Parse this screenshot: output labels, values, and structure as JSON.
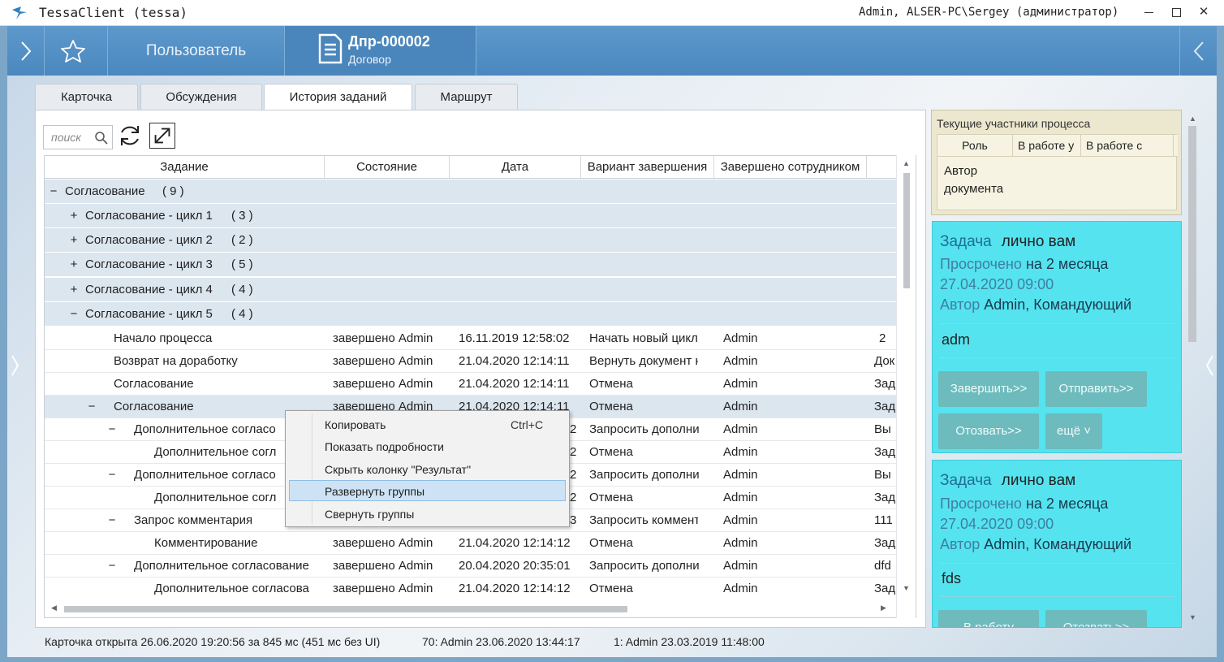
{
  "window": {
    "title": "TessaClient (tessa)",
    "user": "Admin, ALSER-PC\\Sergey (администратор)"
  },
  "toolbar": {
    "user_tab": "Пользователь",
    "doc_number": "Дпр-000002",
    "doc_type": "Договор"
  },
  "tabs": [
    "Карточка",
    "Обсуждения",
    "История заданий",
    "Маршрут"
  ],
  "active_tab": "История заданий",
  "search": {
    "placeholder": "поиск"
  },
  "grid": {
    "columns": [
      "Задание",
      "Состояние",
      "Дата",
      "Вариант завершения",
      "Завершено сотрудником"
    ],
    "groups": [
      {
        "toggle": "−",
        "label": "Согласование",
        "count": "( 9 )"
      },
      {
        "toggle": "+",
        "label": "Согласование - цикл 1",
        "count": "( 3 )"
      },
      {
        "toggle": "+",
        "label": "Согласование - цикл 2",
        "count": "( 2 )"
      },
      {
        "toggle": "+",
        "label": "Согласование - цикл 3",
        "count": "( 5 )"
      },
      {
        "toggle": "+",
        "label": "Согласование - цикл 4",
        "count": "( 4 )"
      },
      {
        "toggle": "−",
        "label": "Согласование - цикл 5",
        "count": "( 4 )"
      }
    ],
    "rows": [
      {
        "toggle": "",
        "task": "Начало процесса",
        "state": "завершено Admin",
        "date": "16.11.2019 12:58:02",
        "option": "Начать новый цикл",
        "by": "Admin",
        "result": "2"
      },
      {
        "toggle": "",
        "task": "Возврат на доработку",
        "state": "завершено Admin",
        "date": "21.04.2020 12:14:11",
        "option": "Вернуть документ н",
        "by": "Admin",
        "result": "Док"
      },
      {
        "toggle": "",
        "task": "Согласование",
        "state": "завершено Admin",
        "date": "21.04.2020 12:14:11",
        "option": "Отмена",
        "by": "Admin",
        "result": "Зад"
      },
      {
        "toggle": "−",
        "task": "Согласование",
        "state": "завершено Admin",
        "date": "21.04.2020 12:14:11",
        "option": "Отмена",
        "by": "Admin",
        "result": "Зад"
      },
      {
        "toggle": "−",
        "task": "Дополнительное согласо",
        "state": "",
        "date": "2",
        "option": "Запросить дополни",
        "by": "Admin",
        "result": "Вы"
      },
      {
        "toggle": "",
        "task": "Дополнительное согл",
        "state": "",
        "date": "2",
        "option": "Отмена",
        "by": "Admin",
        "result": "Зад"
      },
      {
        "toggle": "−",
        "task": "Дополнительное согласо",
        "state": "",
        "date": "2",
        "option": "Запросить дополни",
        "by": "Admin",
        "result": "Вы"
      },
      {
        "toggle": "",
        "task": "Дополнительное согл",
        "state": "",
        "date": "2",
        "option": "Отмена",
        "by": "Admin",
        "result": "Зад"
      },
      {
        "toggle": "−",
        "task": "Запрос комментария",
        "state": "",
        "date": "3",
        "option": "Запросить коммент",
        "by": "Admin",
        "result": "111"
      },
      {
        "toggle": "",
        "task": "Комментирование",
        "state": "завершено Admin",
        "date": "21.04.2020 12:14:12",
        "option": "Отмена",
        "by": "Admin",
        "result": "Зад"
      },
      {
        "toggle": "−",
        "task": "Дополнительное согласование",
        "state": "завершено Admin",
        "date": "20.04.2020 20:35:01",
        "option": "Запросить дополни",
        "by": "Admin",
        "result": "dfd"
      },
      {
        "toggle": "",
        "task": "Дополнительное согласова",
        "state": "завершено Admin",
        "date": "21.04.2020 12:14:12",
        "option": "Отмена",
        "by": "Admin",
        "result": "Зад"
      }
    ]
  },
  "context_menu": {
    "items": [
      {
        "label": "Копировать",
        "shortcut": "Ctrl+C"
      },
      {
        "label": "Показать подробности",
        "shortcut": ""
      },
      {
        "label": "Скрыть колонку \"Результат\"",
        "shortcut": ""
      },
      {
        "label": "Развернуть группы",
        "shortcut": ""
      },
      {
        "label": "Свернуть группы",
        "shortcut": ""
      }
    ],
    "highlighted": "Развернуть группы"
  },
  "participants": {
    "title": "Текущие участники процесса",
    "columns": [
      "Роль",
      "В работе у",
      "В работе с"
    ],
    "role_value": "Автор документа"
  },
  "tasks": [
    {
      "title": "Задача",
      "whom": "лично вам",
      "overdue_prefix": "Просрочено",
      "overdue_value": "на 2 месяца",
      "date": "27.04.2020 09:00",
      "author_prefix": "Автор",
      "author_value": "Admin, Командующий",
      "body": "adm",
      "buttons": [
        "Завершить>>",
        "Отправить>>",
        "Отозвать>>",
        "ещё ˅"
      ]
    },
    {
      "title": "Задача",
      "whom": "лично вам",
      "overdue_prefix": "Просрочено",
      "overdue_value": "на 2 месяца",
      "date": "27.04.2020 09:00",
      "author_prefix": "Автор",
      "author_value": "Admin, Командующий",
      "body": "fds",
      "buttons": [
        "В работу",
        "Отозвать>>"
      ]
    }
  ],
  "status": {
    "opened": "Карточка открыта 26.06.2020 19:20:56 за 845 мс (451 мс без UI)",
    "version": "70:  Admin  23.06.2020 13:44:17",
    "created": "1:  Admin  23.03.2019 11:48:00"
  },
  "colors": {
    "accent": "#4a88bf",
    "task_card": "#55e3ef",
    "task_button": "#6dbbbd",
    "selection": "#cde3f5"
  }
}
